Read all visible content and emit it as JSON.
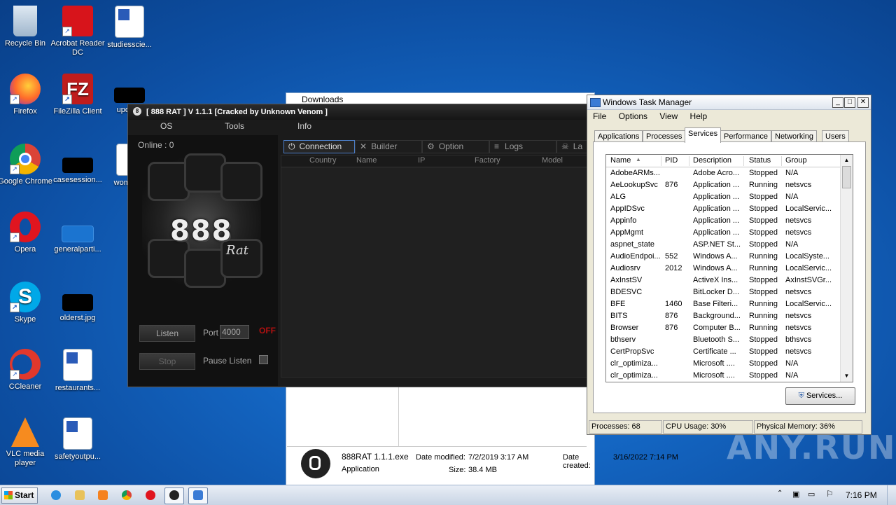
{
  "desktop": {
    "icons": [
      {
        "label": "Recycle Bin"
      },
      {
        "label": "Acrobat Reader DC"
      },
      {
        "label": "studiesscie..."
      },
      {
        "label": "Firefox"
      },
      {
        "label": "FileZilla Client"
      },
      {
        "label": "updat..."
      },
      {
        "label": "Google Chrome"
      },
      {
        "label": "casesession..."
      },
      {
        "label": "woman..."
      },
      {
        "label": "Opera"
      },
      {
        "label": "generalparti..."
      },
      {
        "label": "Skype"
      },
      {
        "label": "olderst.jpg"
      },
      {
        "label": "CCleaner"
      },
      {
        "label": "restaurants..."
      },
      {
        "label": "VLC media player"
      },
      {
        "label": "safetyoutpu..."
      }
    ]
  },
  "explorer": {
    "title": "Downloads",
    "file_name": "888RAT 1.1.1.exe",
    "file_type": "Application",
    "date_modified_label": "Date modified:",
    "date_modified": "7/2/2019 3:17 AM",
    "date_created_label": "Date created:",
    "date_created": "3/16/2022 7:14 PM",
    "size_label": "Size:",
    "size": "38.4 MB"
  },
  "rat": {
    "title": "[  888 RAT  ] V 1.1.1 [Cracked by Unknown Venom ]",
    "menu": [
      "OS",
      "Tools",
      "Info"
    ],
    "online_label": "Online : 0",
    "logo_text": "888",
    "logo_sub": "Rat",
    "listen_label": "Listen",
    "port_label": "Port",
    "port_value": "4000",
    "status_off": "OFF",
    "stop_label": "Stop",
    "pause_label": "Pause Listen",
    "tabs": [
      "Connection",
      "Builder",
      "Option",
      "Logs",
      "La"
    ],
    "columns": [
      "Country",
      "Name",
      "IP",
      "Factory",
      "Model"
    ]
  },
  "taskmgr": {
    "title": "Windows Task Manager",
    "menu": [
      "File",
      "Options",
      "View",
      "Help"
    ],
    "tabs": [
      "Applications",
      "Processes",
      "Services",
      "Performance",
      "Networking",
      "Users"
    ],
    "active_tab": "Services",
    "columns": [
      "Name",
      "PID",
      "Description",
      "Status",
      "Group"
    ],
    "rows": [
      [
        "AdobeARMs...",
        "",
        "Adobe Acro...",
        "Stopped",
        "N/A"
      ],
      [
        "AeLookupSvc",
        "876",
        "Application ...",
        "Running",
        "netsvcs"
      ],
      [
        "ALG",
        "",
        "Application ...",
        "Stopped",
        "N/A"
      ],
      [
        "AppIDSvc",
        "",
        "Application ...",
        "Stopped",
        "LocalServic..."
      ],
      [
        "Appinfo",
        "",
        "Application ...",
        "Stopped",
        "netsvcs"
      ],
      [
        "AppMgmt",
        "",
        "Application ...",
        "Stopped",
        "netsvcs"
      ],
      [
        "aspnet_state",
        "",
        "ASP.NET St...",
        "Stopped",
        "N/A"
      ],
      [
        "AudioEndpoi...",
        "552",
        "Windows A...",
        "Running",
        "LocalSyste..."
      ],
      [
        "Audiosrv",
        "2012",
        "Windows A...",
        "Running",
        "LocalServic..."
      ],
      [
        "AxInstSV",
        "",
        "ActiveX Ins...",
        "Stopped",
        "AxInstSVGr..."
      ],
      [
        "BDESVC",
        "",
        "BitLocker D...",
        "Stopped",
        "netsvcs"
      ],
      [
        "BFE",
        "1460",
        "Base Filteri...",
        "Running",
        "LocalServic..."
      ],
      [
        "BITS",
        "876",
        "Background...",
        "Running",
        "netsvcs"
      ],
      [
        "Browser",
        "876",
        "Computer B...",
        "Running",
        "netsvcs"
      ],
      [
        "bthserv",
        "",
        "Bluetooth S...",
        "Stopped",
        "bthsvcs"
      ],
      [
        "CertPropSvc",
        "",
        "Certificate ...",
        "Stopped",
        "netsvcs"
      ],
      [
        "clr_optimiza...",
        "",
        "Microsoft ....",
        "Stopped",
        "N/A"
      ],
      [
        "clr_optimiza...",
        "",
        "Microsoft ....",
        "Stopped",
        "N/A"
      ]
    ],
    "services_button": "Services...",
    "status_processes": "Processes: 68",
    "status_cpu": "CPU Usage: 30%",
    "status_memory": "Physical Memory: 36%"
  },
  "taskbar": {
    "start_label": "Start",
    "clock": "7:16 PM"
  },
  "watermark": "ANY.RUN"
}
